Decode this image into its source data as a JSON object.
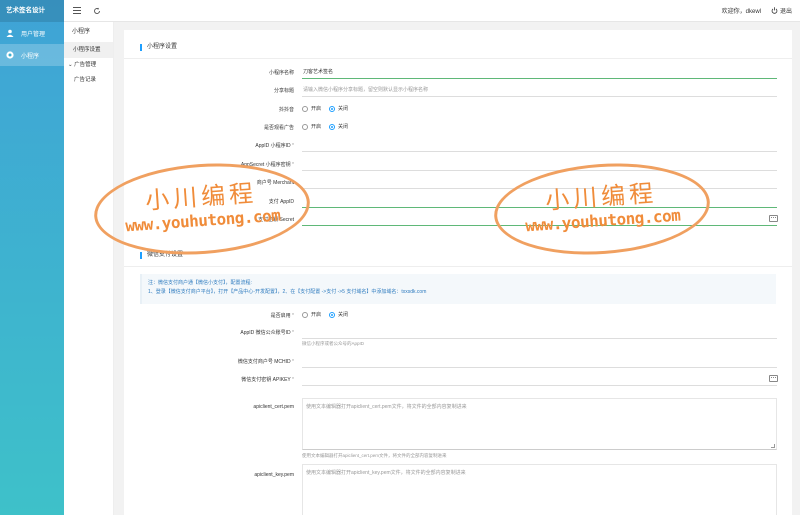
{
  "app": {
    "brand": "艺术签名设计"
  },
  "sidebar": {
    "items": [
      {
        "label": "用户管理",
        "icon": "user-icon"
      },
      {
        "label": "小程序",
        "icon": "miniprogram-icon"
      }
    ]
  },
  "topbar": {
    "welcome": "欢迎你，dkewl",
    "logout": "退出"
  },
  "subnav": {
    "title": "小程序",
    "settings": "小程序设置",
    "group": "广告管理",
    "child": "广告记录"
  },
  "mini_settings": {
    "title": "小程序设置",
    "name_label": "小程序名称",
    "name_value": "刀客艺术签名",
    "share_label": "分享标题",
    "share_placeholder": "请输入微信小程序分享标题，留空则默认显示小程序名称",
    "tiktok_label": "抖抖音",
    "ads_label": "是否观看广告",
    "on": "开启",
    "off": "关闭",
    "appid_label": "AppID 小程序ID",
    "secret_label": "AppSecret 小程序密钥",
    "merchant_label": "商户号 Merchant",
    "payid_label": "支付 AppID",
    "paykey_label": "支付密钥 Secret",
    "req": "*"
  },
  "wechat_pay": {
    "title": "微信支付设置",
    "notice_line1": "注：微信支付商户通【微信小支付】，配置流程:",
    "notice_line2": "1、登录【微信支付商户平台】，打开【产品中心-开发配置】，2、在【支付配置 ->支付 ->5 支付域名】中添加域名：txxsdk.com",
    "enable_label": "是否启用",
    "appid_label": "AppID 微信公众账号ID",
    "appid_help": "微信小程序或者公众号的AppID",
    "mchid_label": "微信支付商户号 MCHID",
    "apikey_label": "微信支付密钥 APIKEY",
    "cert_label": "apiclient_cert.pem",
    "cert_placeholder": "使用文本编辑器打开apiclient_cert.pem文件，将文件的全部内容复制进来",
    "cert_help": "使用文本编辑器打开apiclient_cert.pem文件，将文件的全部内容复制进来",
    "key_label": "apiclient_key.pem",
    "key_placeholder": "使用文本编辑器打开apiclient_key.pem文件，将文件的全部内容复制进来"
  },
  "watermark": {
    "line1": "小川编程",
    "line2": "www.youhutong.com"
  },
  "colors": {
    "accent": "#1e9fff",
    "sidebar_top": "#3fa3d6",
    "sidebar_bottom": "#3ec1c9",
    "watermark": "#f08c3a"
  }
}
